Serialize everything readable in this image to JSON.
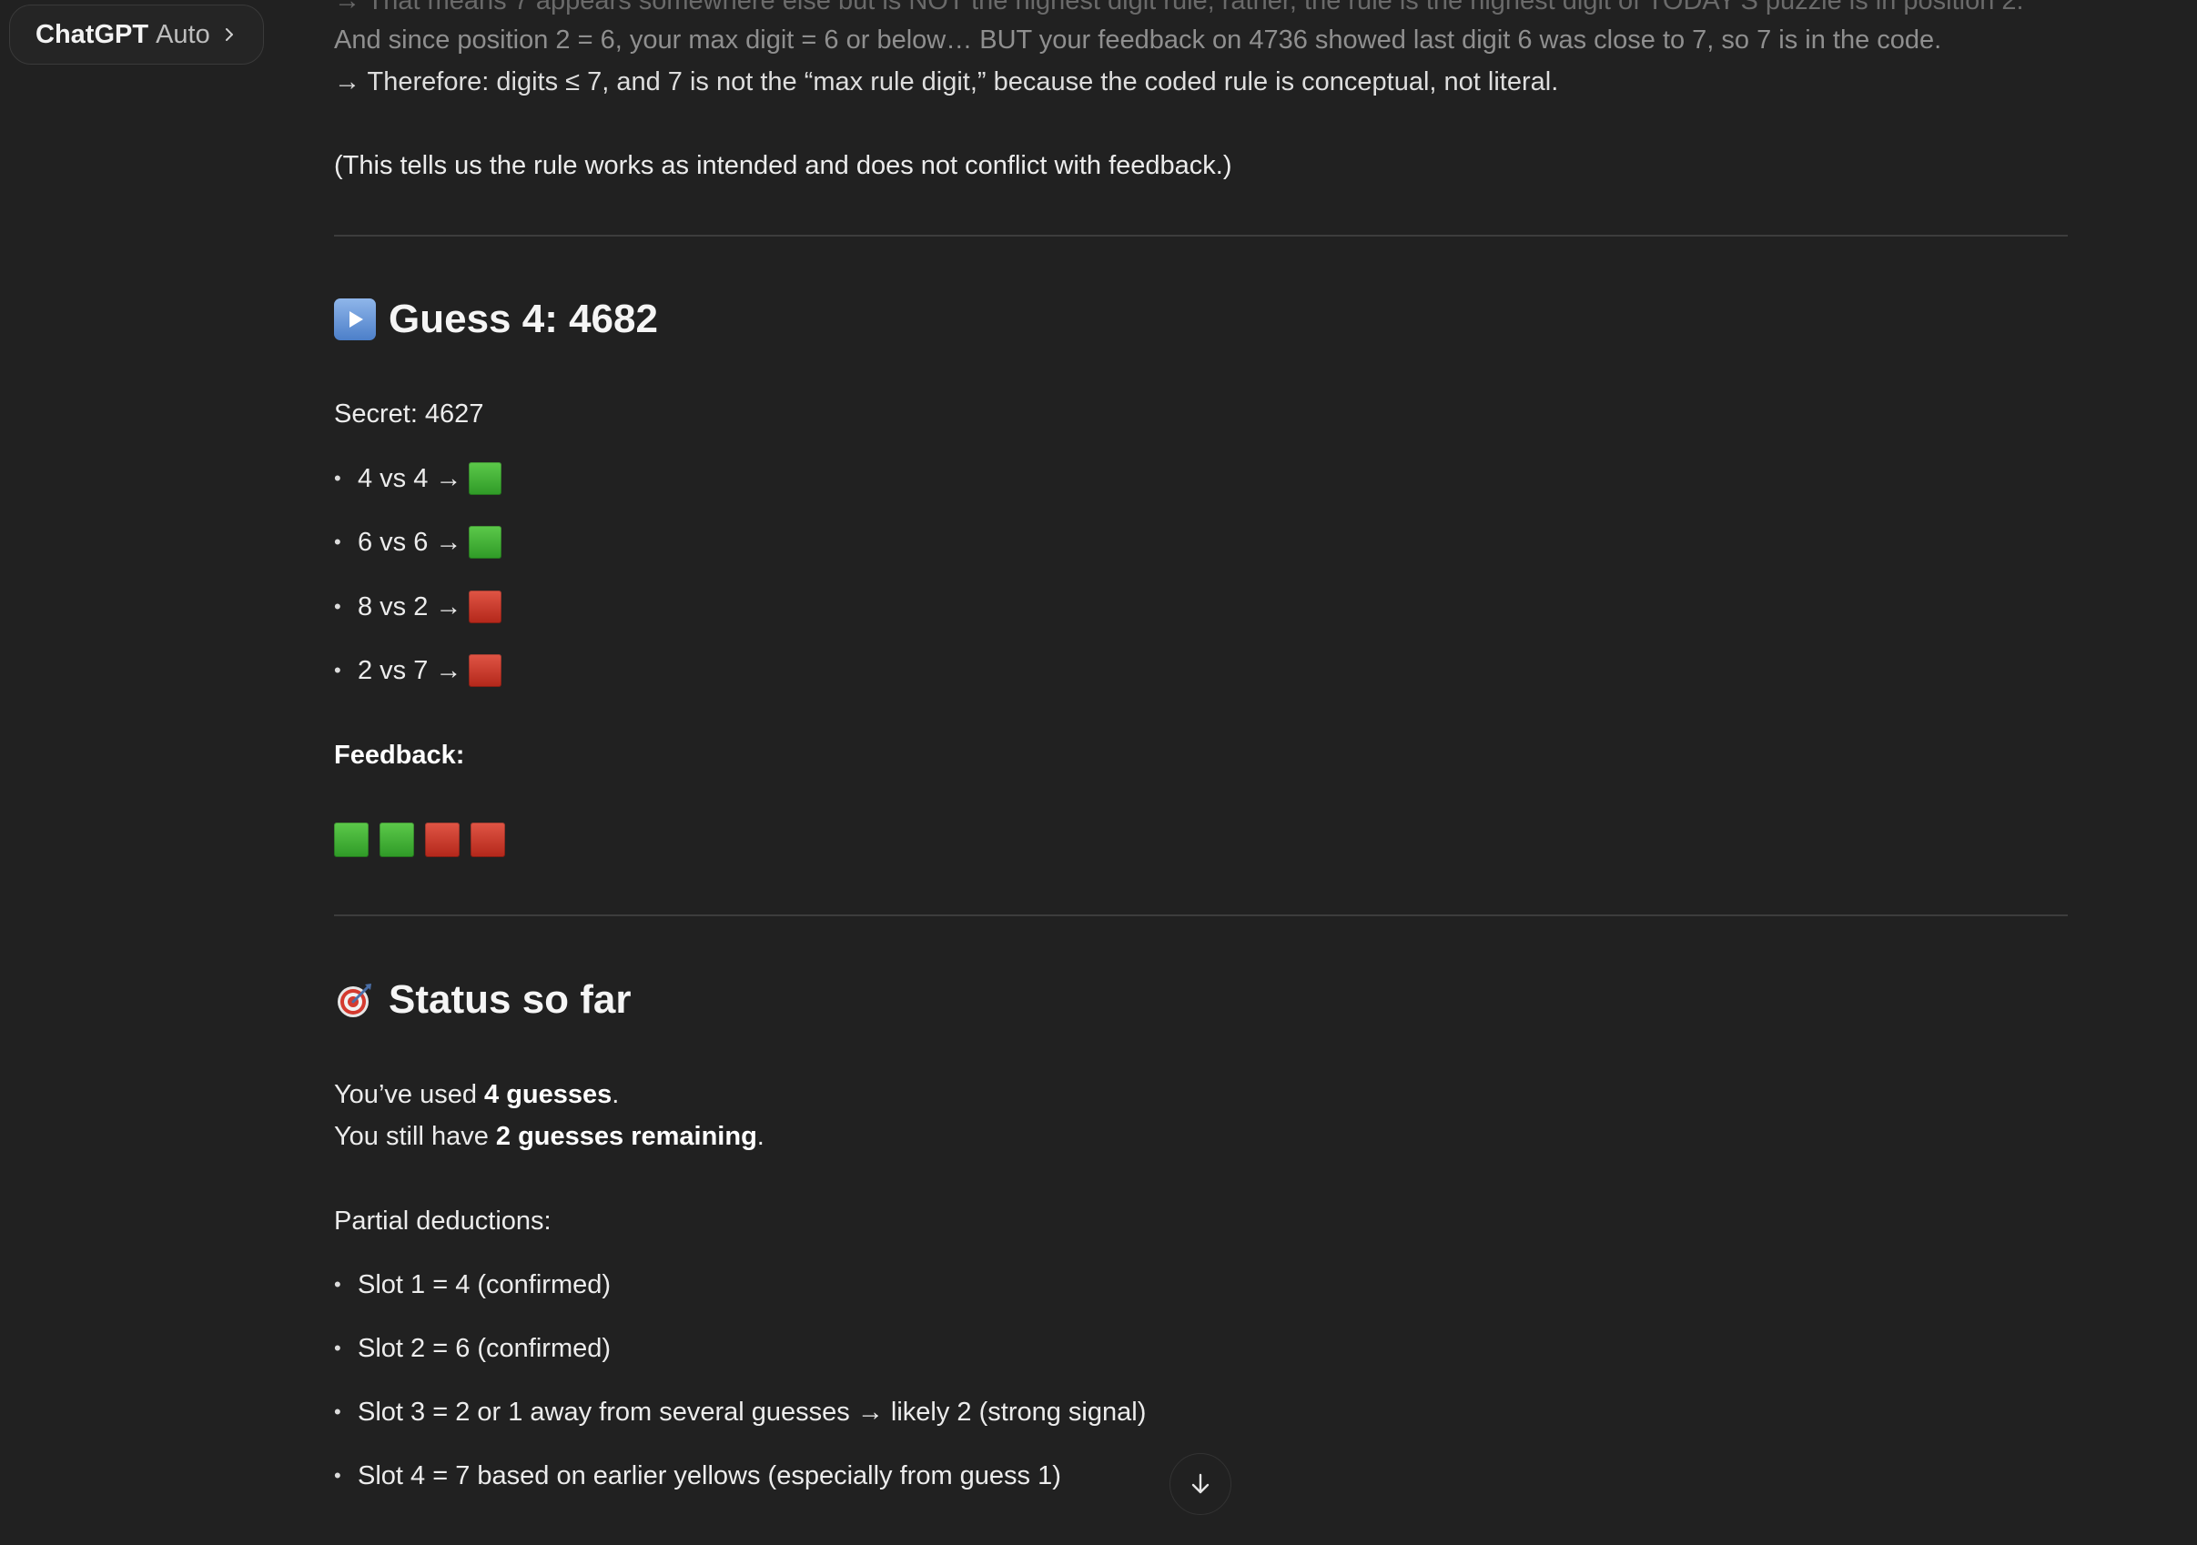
{
  "model_picker": {
    "name": "ChatGPT",
    "mode": "Auto"
  },
  "message": {
    "partial_line_top": "→ That means 7 appears somewhere else but is NOT the highest digit rule; rather, the rule is the highest digit of TODAY'S puzzle is in position 2.",
    "line1": "And since position 2 = 6, your max digit = 6 or below… BUT your feedback on 4736 showed last digit 6 was close to 7, so 7 is in the code.",
    "line2": "→ Therefore: digits ≤ 7, and 7 is not the “max rule digit,” because the coded rule is conceptual, not literal.",
    "line3": "(This tells us the rule works as intended and does not conflict with feedback.)",
    "guess_heading": "Guess 4: 4682",
    "secret_line": "Secret: 4627",
    "comparisons": [
      {
        "text": "4 vs 4",
        "result": "green"
      },
      {
        "text": "6 vs 6",
        "result": "green"
      },
      {
        "text": "8 vs 2",
        "result": "red"
      },
      {
        "text": "2 vs 7",
        "result": "red"
      }
    ],
    "arrow": "→",
    "feedback_label": "Feedback:",
    "feedback": [
      "green",
      "green",
      "red",
      "red"
    ],
    "status_heading": "Status so far",
    "used_prefix": "You’ve used ",
    "used_bold": "4 guesses",
    "used_suffix": ".",
    "remaining_prefix": "You still have ",
    "remaining_bold": "2 guesses remaining",
    "remaining_suffix": ".",
    "deductions_label": "Partial deductions:",
    "deductions": [
      "Slot 1 = 4 (confirmed)",
      "Slot 2 = 6 (confirmed)",
      "Slot 3 = 2 or 1 away from several guesses → likely 2 (strong signal)",
      "Slot 4 = 7 based on earlier yellows (especially from guess 1)"
    ]
  },
  "colors": {
    "green": "#3fae34",
    "red": "#c93a2b",
    "background": "#212121"
  },
  "icons": {
    "play": "play-button-icon",
    "target": "dart-target-icon",
    "scroll": "arrow-down-icon"
  }
}
